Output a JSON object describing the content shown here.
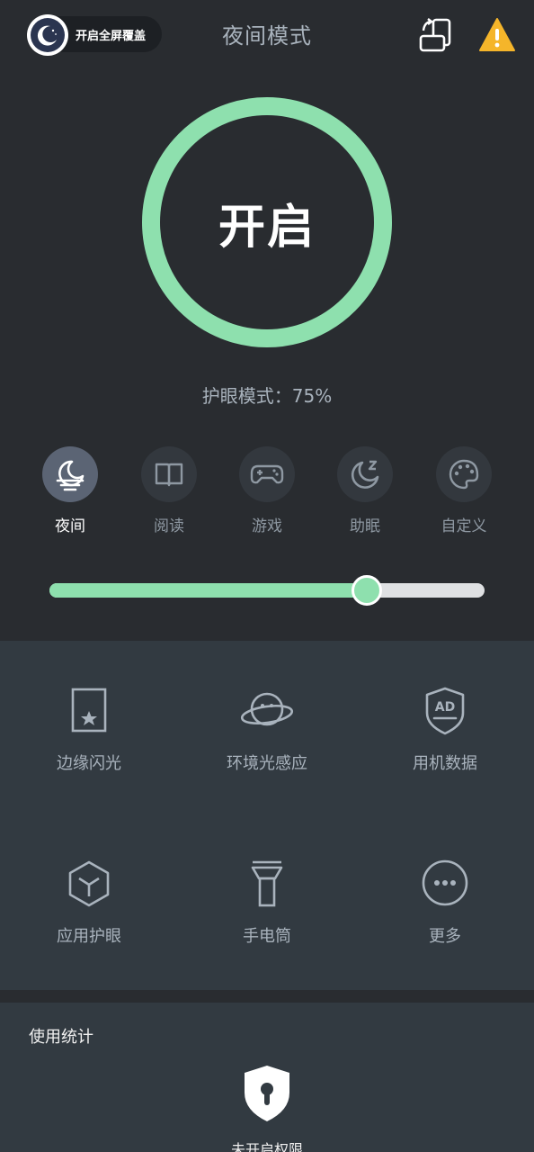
{
  "header": {
    "fullscreen_label": "开启全屏覆盖",
    "title": "夜间模式",
    "icons": [
      "moon-icon",
      "rotate-screen-icon",
      "warning-icon"
    ]
  },
  "power": {
    "label": "开启"
  },
  "status": {
    "text": "护眼模式：75%"
  },
  "modes": [
    {
      "label": "夜间",
      "icon": "night-moon-icon",
      "active": true
    },
    {
      "label": "阅读",
      "icon": "book-icon",
      "active": false
    },
    {
      "label": "游戏",
      "icon": "gamepad-icon",
      "active": false
    },
    {
      "label": "助眠",
      "icon": "sleep-moon-icon",
      "active": false
    },
    {
      "label": "自定义",
      "icon": "palette-icon",
      "active": false
    }
  ],
  "slider": {
    "value_fraction": 0.73
  },
  "tools": [
    {
      "label": "边缘闪光",
      "icon": "edge-flash-icon"
    },
    {
      "label": "环境光感应",
      "icon": "planet-face-icon"
    },
    {
      "label": "用机数据",
      "icon": "ad-shield-icon"
    },
    {
      "label": "应用护眼",
      "icon": "cube-icon"
    },
    {
      "label": "手电筒",
      "icon": "flashlight-icon"
    },
    {
      "label": "更多",
      "icon": "more-icon"
    }
  ],
  "stats": {
    "title": "使用统计",
    "message": "未开启权限",
    "icon": "lock-shield-icon"
  },
  "colors": {
    "background": "#292c30",
    "panel": "#323a41",
    "accent": "#8ee0ae",
    "muted_text": "#a9b3bd",
    "warning": "#f5b52a"
  }
}
